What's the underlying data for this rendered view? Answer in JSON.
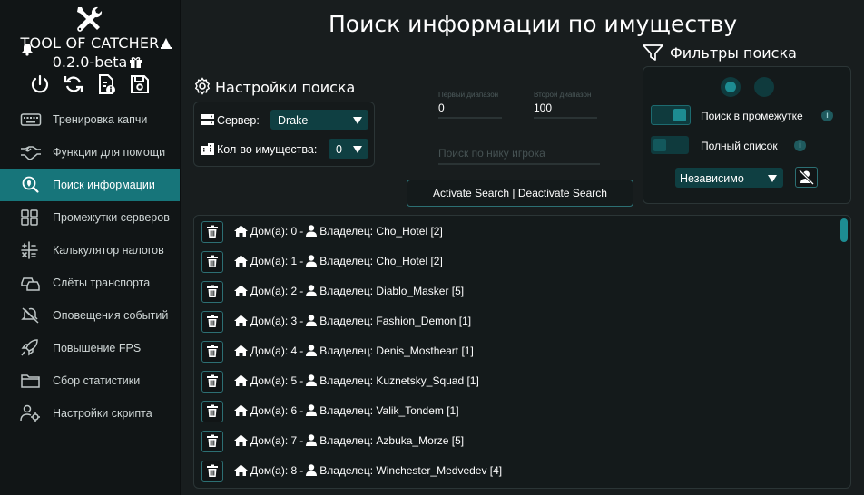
{
  "app": {
    "title": "TOOL OF CATCHER",
    "version": "0.2.0-beta"
  },
  "sidebar": {
    "items": [
      {
        "label": "Тренировка капчи",
        "icon": "keyboard-icon"
      },
      {
        "label": "Функции для помощи",
        "icon": "handshake-icon"
      },
      {
        "label": "Поиск информации",
        "icon": "search-location-icon",
        "active": true
      },
      {
        "label": "Промежутки серверов",
        "icon": "grid-icon"
      },
      {
        "label": "Калькулятор налогов",
        "icon": "calculator-icon"
      },
      {
        "label": "Слёты транспорта",
        "icon": "car-icon"
      },
      {
        "label": "Оповещения событий",
        "icon": "bell-icon"
      },
      {
        "label": "Повышение FPS",
        "icon": "rocket-icon"
      },
      {
        "label": "Сбор статистики",
        "icon": "folder-icon"
      },
      {
        "label": "Настройки скрипта",
        "icon": "user-gear-icon"
      }
    ]
  },
  "main": {
    "title": "Поиск информации по имуществу"
  },
  "settings": {
    "heading": "Настройки поиска",
    "server_label": "Сервер:",
    "server_value": "Drake",
    "count_label": "Кол-во имущества:",
    "count_value": "0"
  },
  "range": {
    "first_label": "Первый диапазон",
    "first_value": "0",
    "second_label": "Второй диапазон",
    "second_value": "100",
    "nick_placeholder": "Поиск по нику игрока"
  },
  "actions": {
    "toggle_search": "Activate Search | Deactivate Search"
  },
  "filters": {
    "heading": "Фильтры поиска",
    "range_search": "Поиск в промежутке",
    "full_list": "Полный список",
    "mode_value": "Независимо"
  },
  "colors": {
    "accent": "#17757a",
    "accent_bright": "#1d8c92",
    "select_bg": "#0f3f42",
    "background": "#181d1e",
    "sidebar_bg": "#111516"
  },
  "results": {
    "house_label": "Дом(а):",
    "owner_label": "Владелец:",
    "rows": [
      {
        "id": "0",
        "owner": "Cho_Hotel [2]"
      },
      {
        "id": "1",
        "owner": "Cho_Hotel [2]"
      },
      {
        "id": "2",
        "owner": "Diablo_Masker [5]"
      },
      {
        "id": "3",
        "owner": "Fashion_Demon [1]"
      },
      {
        "id": "4",
        "owner": "Denis_Mostheart [1]"
      },
      {
        "id": "5",
        "owner": "Kuznetsky_Squad [1]"
      },
      {
        "id": "6",
        "owner": "Valik_Tondem [1]"
      },
      {
        "id": "7",
        "owner": "Azbuka_Morze [5]"
      },
      {
        "id": "8",
        "owner": "Winchester_Medvedev [4]"
      }
    ]
  }
}
